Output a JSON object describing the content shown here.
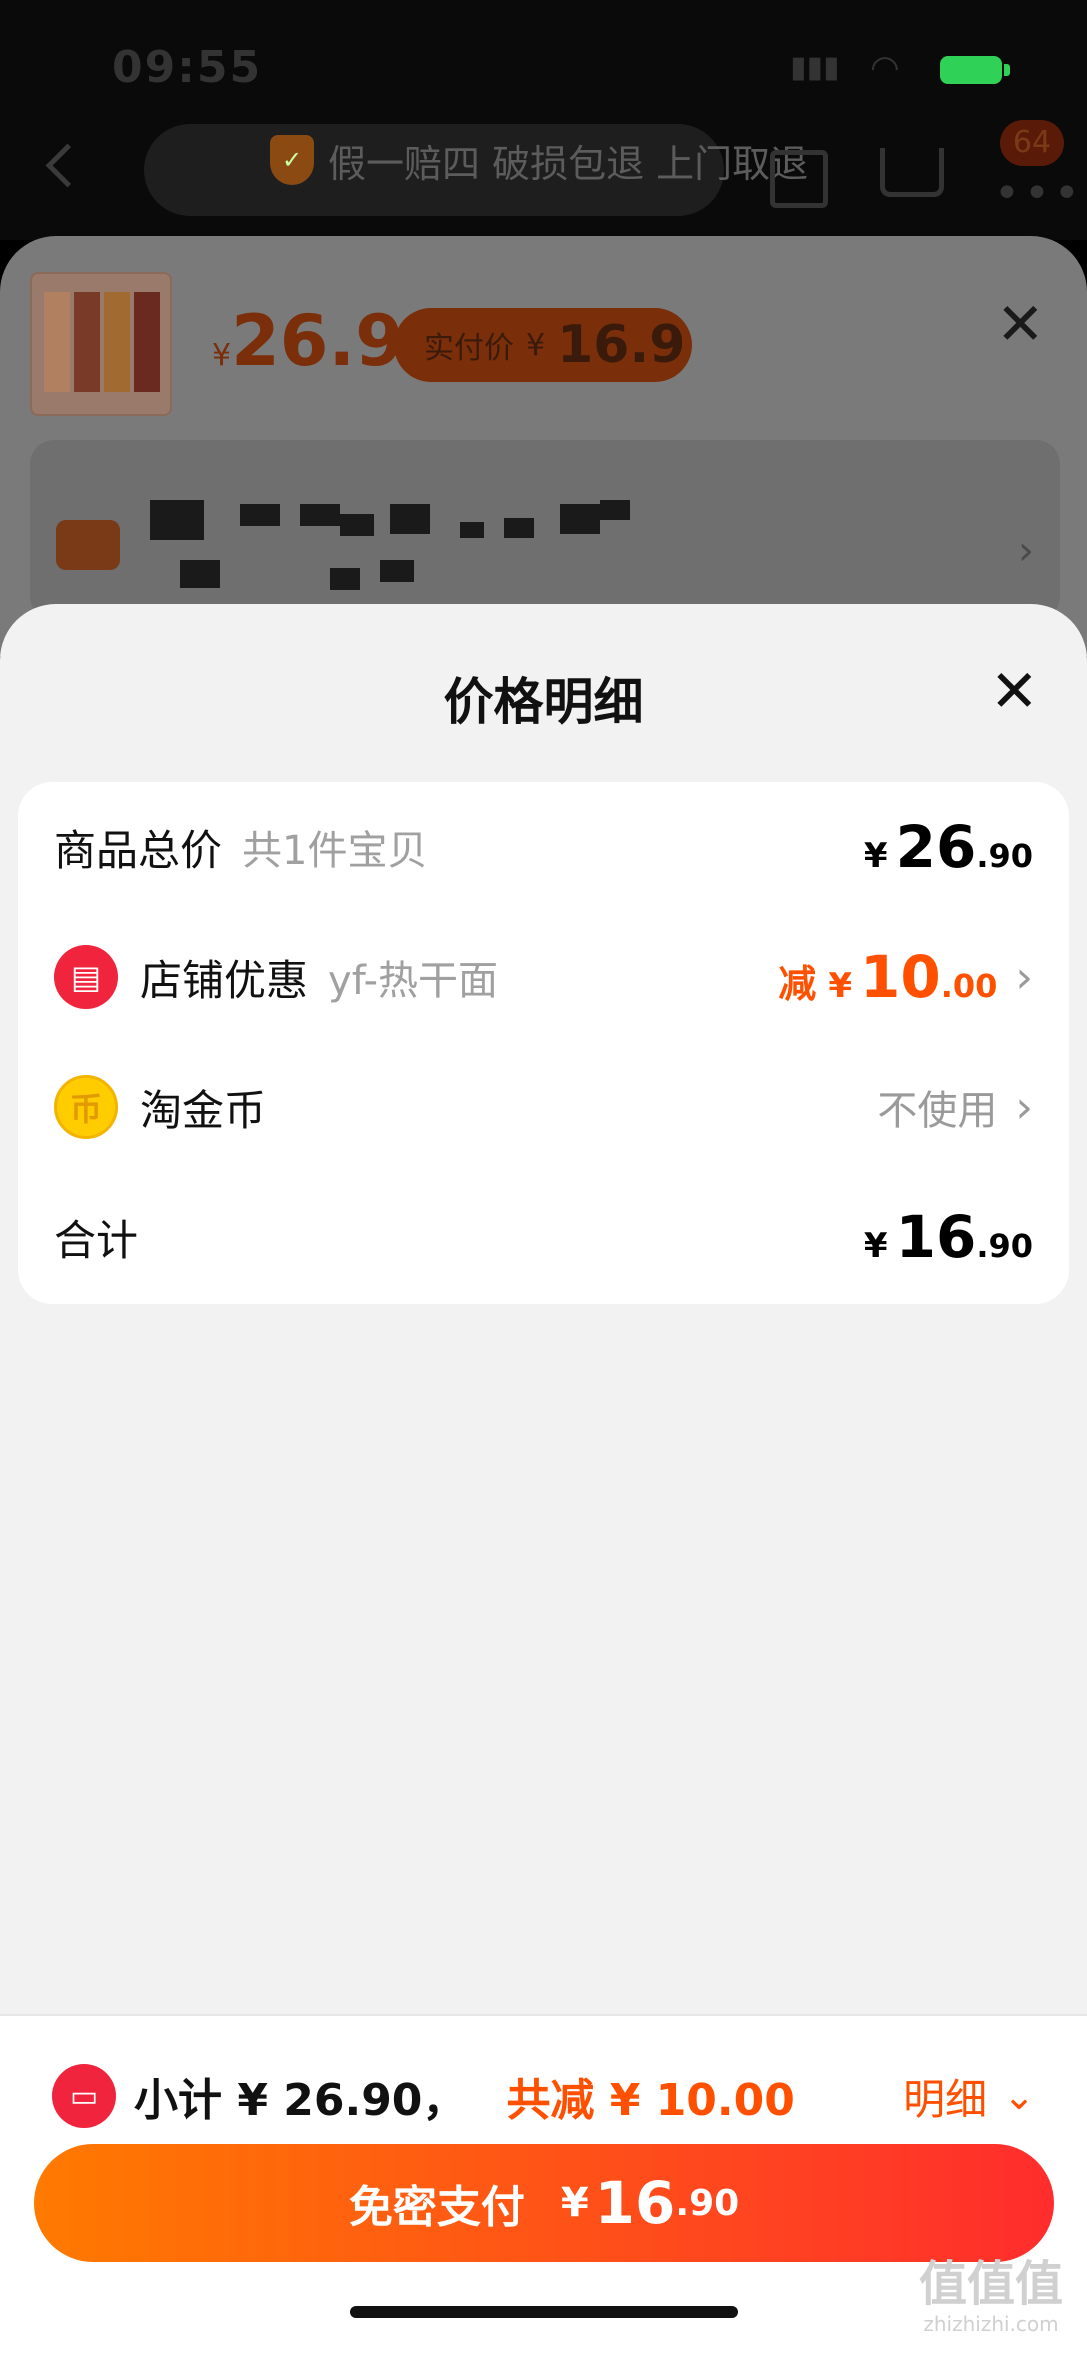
{
  "status_bar": {
    "time": "09:55"
  },
  "header": {
    "guarantee_text": "假一赔四 破损包退 上门取退",
    "cart_badge": "64"
  },
  "product_bg": {
    "price": "26.9",
    "paid_label": "实付价",
    "paid_price": "16.9",
    "currency": "¥"
  },
  "sheet": {
    "title": "价格明细",
    "rows": {
      "total": {
        "label": "商品总价",
        "sub": "共1件宝贝",
        "yen": "¥",
        "int": "26",
        "dec": ".90"
      },
      "store": {
        "label": "店铺优惠",
        "sub": "yf-热干面",
        "prefix": "减",
        "yen": "¥",
        "int": "10",
        "dec": ".00"
      },
      "coins": {
        "label": "淘金币",
        "value": "不使用"
      },
      "sum": {
        "label": "合计",
        "yen": "¥",
        "int": "16",
        "dec": ".90"
      }
    }
  },
  "footer": {
    "subtotal": "小计 ¥ 26.90，",
    "saved": "共减 ¥ 10.00",
    "detail": "明细",
    "pay_label": "免密支付",
    "pay_yen": "¥",
    "pay_int": "16",
    "pay_dec": ".90"
  },
  "watermark": {
    "main": "值值值",
    "sub": "zhizhizhi.com"
  },
  "colors": {
    "accent": "#ff5000",
    "brand_red": "#f0243c",
    "gradient_start": "#ff7a00",
    "gradient_end": "#ff2d2d"
  }
}
